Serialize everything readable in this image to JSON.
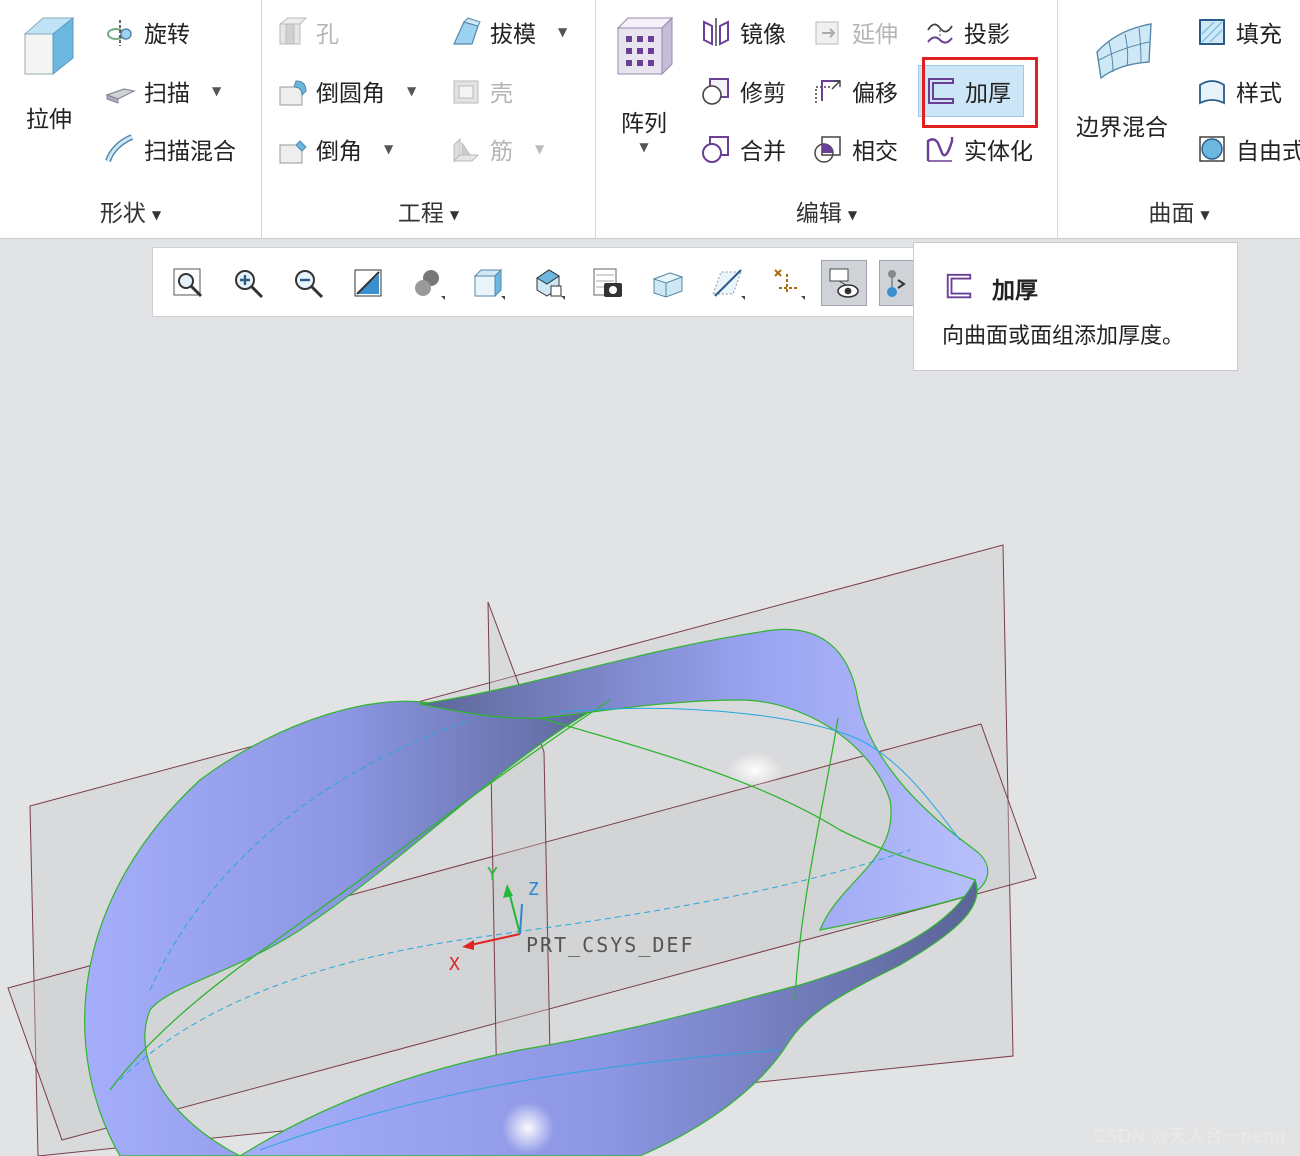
{
  "ribbon": {
    "shape": {
      "label": "形状",
      "extrude": "拉伸",
      "revolve": "旋转",
      "sweep": "扫描",
      "swept_blend": "扫描混合"
    },
    "engineering": {
      "label": "工程",
      "hole": "孔",
      "draft": "拔模",
      "round": "倒圆角",
      "shell": "壳",
      "chamfer": "倒角",
      "rib": "筋"
    },
    "editing": {
      "label": "编辑",
      "pattern": "阵列",
      "mirror": "镜像",
      "extend": "延伸",
      "project": "投影",
      "trim": "修剪",
      "offset": "偏移",
      "thicken": "加厚",
      "merge": "合并",
      "intersect": "相交",
      "solidify": "实体化"
    },
    "surfaces": {
      "label": "曲面",
      "boundary_blend": "边界混合",
      "fill": "填充",
      "style": "样式",
      "freestyle": "自由式"
    }
  },
  "tooltip": {
    "title": "加厚",
    "description": "向曲面或面组添加厚度。"
  },
  "viewport": {
    "csys_label": "PRT_CSYS_DEF",
    "axis_x": "X",
    "axis_y": "Y",
    "axis_z": "Z"
  },
  "watermark": "CSDN @天人合一peng",
  "colors": {
    "highlight": "#e0201f",
    "surface": "#9ea8f0",
    "edge": "#2fb52f",
    "plane": "#7a3d4a"
  }
}
